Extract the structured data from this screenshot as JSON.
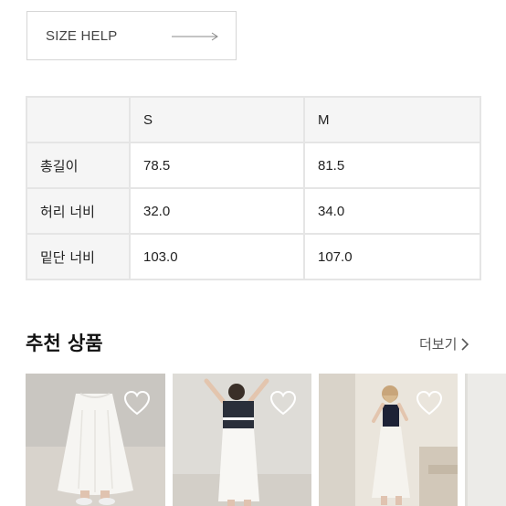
{
  "size_help": {
    "label": "SIZE HELP"
  },
  "size_table": {
    "headers": [
      "",
      "S",
      "M"
    ],
    "rows": [
      {
        "label": "총길이",
        "values": [
          "78.5",
          "81.5"
        ]
      },
      {
        "label": "허리 너비",
        "values": [
          "32.0",
          "34.0"
        ]
      },
      {
        "label": "밑단 너비",
        "values": [
          "103.0",
          "107.0"
        ]
      }
    ]
  },
  "recommended": {
    "title": "추천 상품",
    "more_label": "더보기",
    "products": [
      {
        "name": "product-1",
        "icon": "heart-icon"
      },
      {
        "name": "product-2",
        "icon": "heart-icon"
      },
      {
        "name": "product-3",
        "icon": "heart-icon"
      },
      {
        "name": "product-4",
        "icon": "heart-icon"
      }
    ]
  },
  "colors": {
    "border": "#e5e5e5",
    "header_bg": "#f5f5f5",
    "text": "#222222"
  }
}
